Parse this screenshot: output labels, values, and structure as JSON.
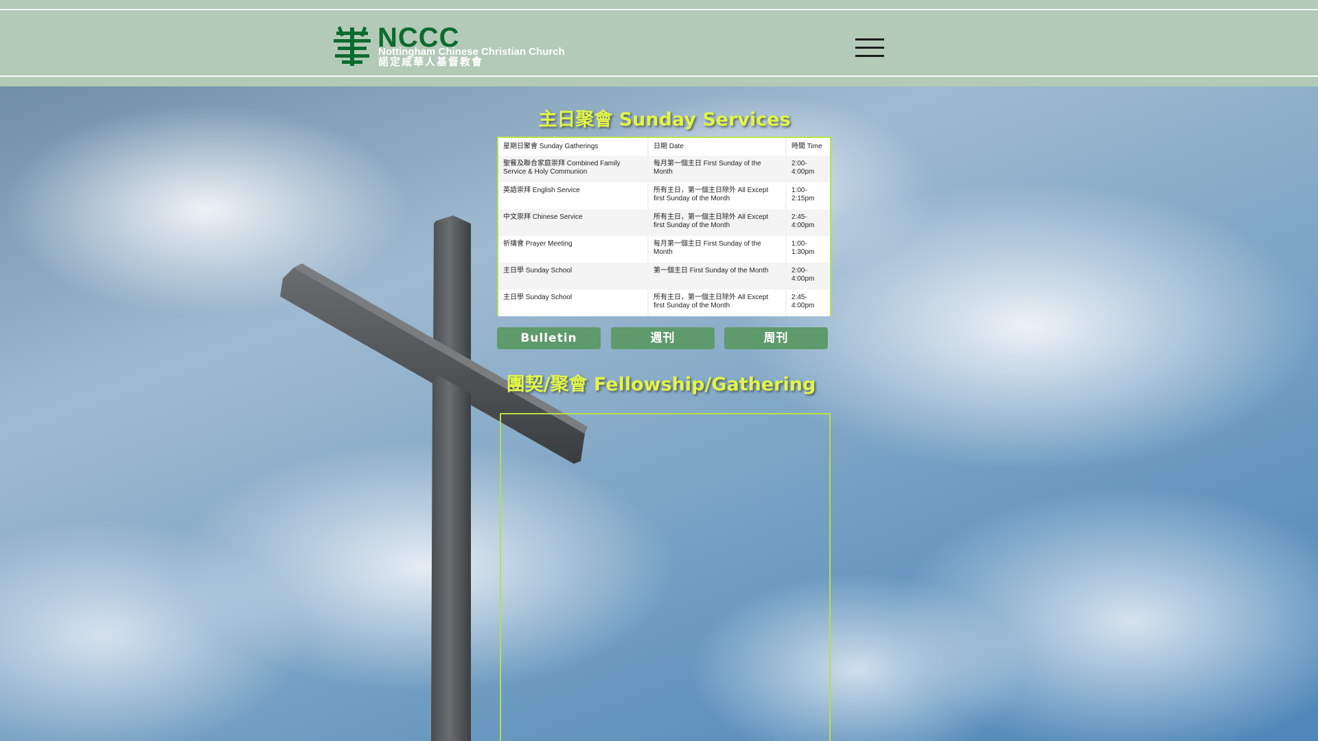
{
  "header": {
    "logo": {
      "abbr": "NCCC",
      "name_en": "Nottingham Chinese Christian Church",
      "name_zh": "諾定咸華人基督教會",
      "icon": "tree-icon",
      "brand_color": "#0b6b2e"
    },
    "menu_icon": "hamburger-menu-icon",
    "background_color": "#b2cab6"
  },
  "services": {
    "title": "主日聚會 Sunday Services",
    "columns": [
      "星期日聚會 Sunday Gatherings",
      "日期 Date",
      "時間 Time"
    ],
    "rows": [
      [
        "聖餐及聯合家庭崇拜 Combined Family Service & Holy Communion",
        "每月第一個主日 First Sunday of the Month",
        "2:00-4:00pm"
      ],
      [
        "英語崇拜 English Service",
        "所有主日，第一個主日除外 All Except first Sunday of the Month",
        "1:00-2:15pm"
      ],
      [
        "中文崇拜 Chinese Service",
        "所有主日，第一個主日除外 All Except first Sunday of the Month",
        "2:45-4:00pm"
      ],
      [
        "祈禱會 Prayer Meeting",
        "每月第一個主日 First Sunday of the Month",
        "1:00-1:30pm"
      ],
      [
        "主日學 Sunday School",
        "第一個主日 First Sunday of the Month",
        "2:00-4:00pm"
      ],
      [
        "主日學 Sunday School",
        "所有主日，第一個主日除外 All Except first Sunday of the Month",
        "2:45-4:00pm"
      ]
    ]
  },
  "buttons": {
    "bulletin": "Bulletin",
    "bulletin_trad": "週刊",
    "bulletin_simp": "周刊",
    "color": "#5f9a6c"
  },
  "fellowship": {
    "title": "團契/聚會 Fellowship/Gathering"
  },
  "colors": {
    "title_accent": "#e1f54a",
    "frame_border": "#b8e046"
  }
}
